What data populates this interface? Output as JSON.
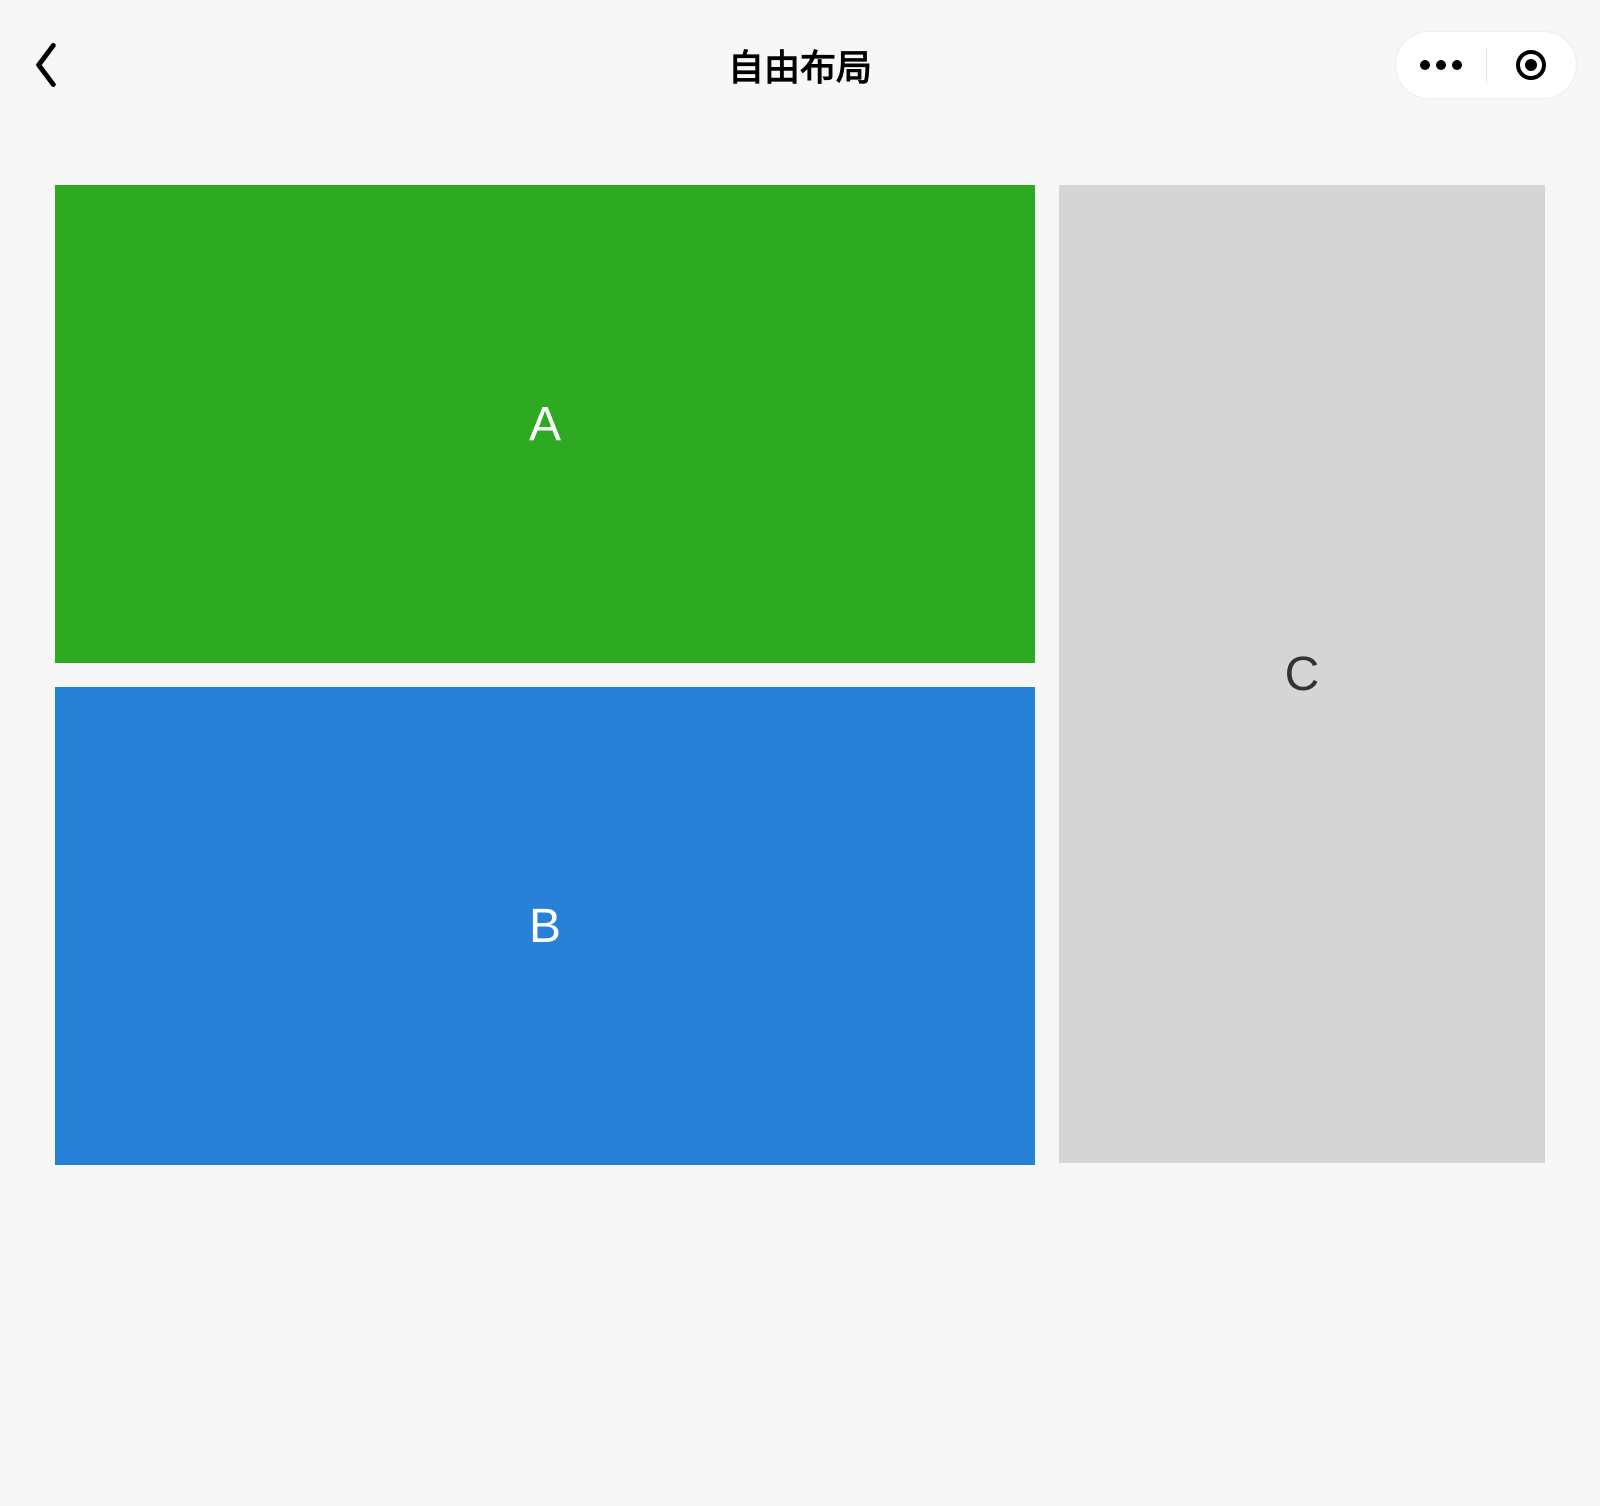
{
  "header": {
    "title": "自由布局"
  },
  "blocks": {
    "a": {
      "label": "A",
      "color": "#2eaa22"
    },
    "b": {
      "label": "B",
      "color": "#2782d7"
    },
    "c": {
      "label": "C",
      "color": "#d5d5d5"
    }
  }
}
